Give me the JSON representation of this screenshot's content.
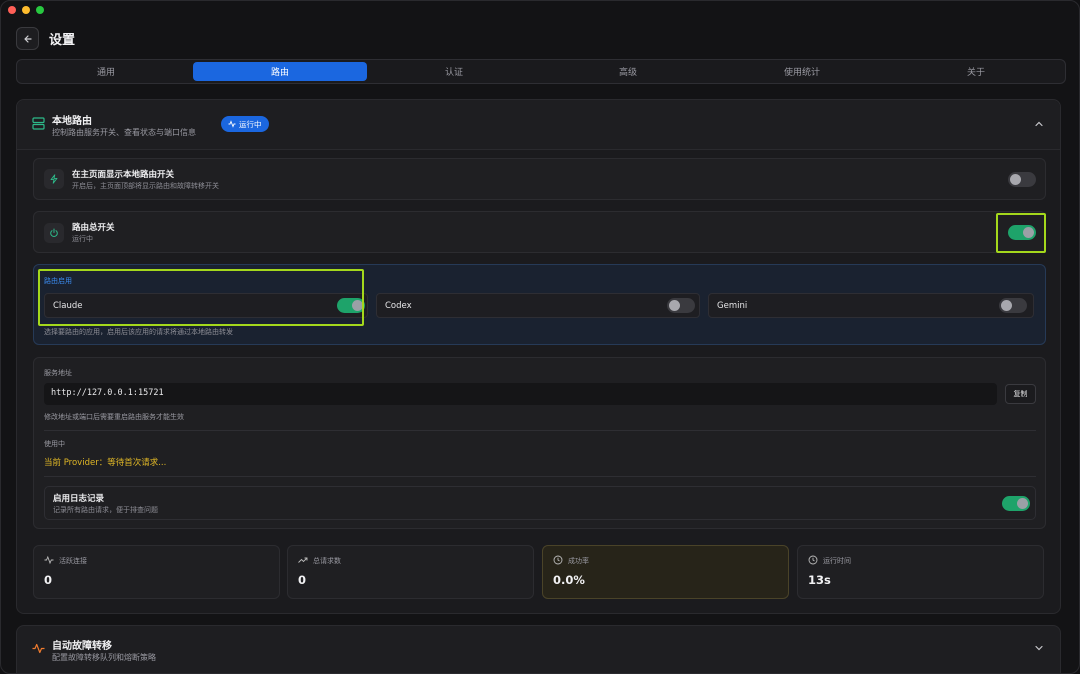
{
  "header": {
    "title": "设置"
  },
  "tabs": [
    {
      "label": "通用"
    },
    {
      "label": "路由",
      "active": true
    },
    {
      "label": "认证"
    },
    {
      "label": "高级"
    },
    {
      "label": "使用统计"
    },
    {
      "label": "关于"
    }
  ],
  "local_routing": {
    "title": "本地路由",
    "subtitle": "控制路由服务开关、查看状态与端口信息",
    "badge": "运行中",
    "show_toggle": {
      "title": "在主页面显示本地路由开关",
      "subtitle": "开启后，主页面顶部将显示路由和故障转移开关",
      "on": false
    },
    "master_switch": {
      "title": "路由总开关",
      "subtitle": "运行中",
      "on": true
    },
    "apps": {
      "label": "路由启用",
      "items": [
        {
          "name": "Claude",
          "on": true
        },
        {
          "name": "Codex",
          "on": false
        },
        {
          "name": "Gemini",
          "on": false
        }
      ],
      "hint": "选择要路由的应用，启用后该应用的请求将通过本地路由转发"
    },
    "service": {
      "address_label": "服务地址",
      "address": "http://127.0.0.1:15721",
      "copy_label": "复制",
      "address_hint": "修改地址或端口后需要重启路由服务才能生效",
      "in_use_label": "使用中",
      "provider_text": "当前 Provider：等待首次请求...",
      "log": {
        "title": "启用日志记录",
        "subtitle": "记录所有路由请求，便于排查问题",
        "on": true
      }
    },
    "stats": [
      {
        "label": "活跃连接",
        "value": "0",
        "icon": "activity-icon"
      },
      {
        "label": "总请求数",
        "value": "0",
        "icon": "trending-up-icon"
      },
      {
        "label": "成功率",
        "value": "0.0%",
        "icon": "clock-icon"
      },
      {
        "label": "运行时间",
        "value": "13s",
        "icon": "clock-icon"
      }
    ]
  },
  "failover": {
    "title": "自动故障转移",
    "subtitle": "配置故障转移队列和熔断策略"
  },
  "colors": {
    "accent_blue": "#1b67e0",
    "toggle_on": "#1ea36a",
    "highlight": "#a4d81c",
    "provider_text": "#e0b726"
  }
}
